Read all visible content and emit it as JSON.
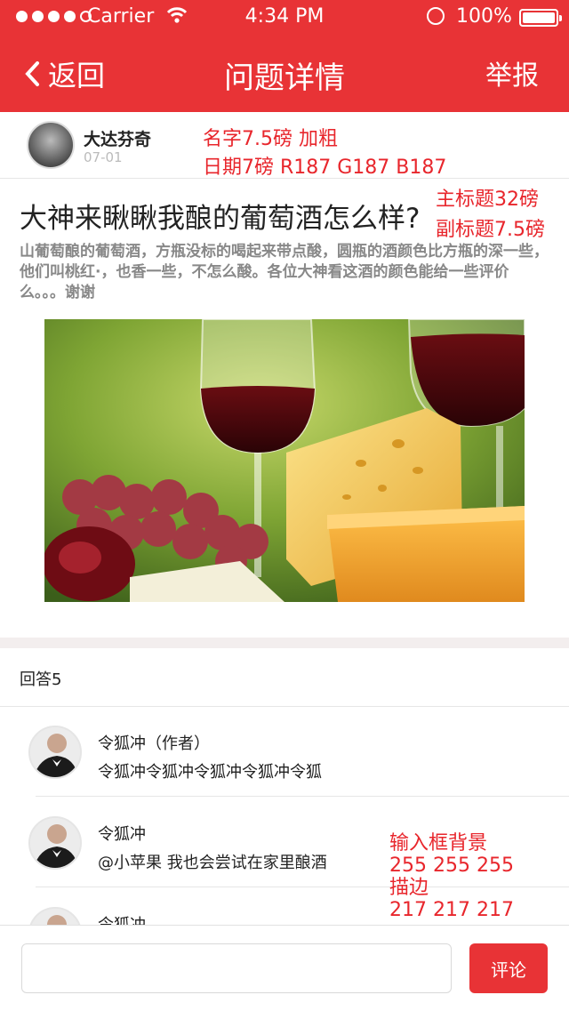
{
  "status_bar": {
    "carrier": "Carrier",
    "time": "4:34 PM",
    "battery": "100%"
  },
  "nav": {
    "back_label": "返回",
    "title": "问题详情",
    "report_label": "举报"
  },
  "author": {
    "name": "大达芬奇",
    "date": "07-01"
  },
  "annotations": {
    "name_spec": "名字7.5磅 加粗",
    "date_spec": "日期7磅 R187 G187 B187",
    "title_spec": "主标题32磅",
    "subtitle_spec": "副标题7.5磅",
    "input_spec_1": "输入框背景",
    "input_spec_2": "255 255 255",
    "input_spec_3": "描边",
    "input_spec_4": "217 217 217"
  },
  "question": {
    "title": "大神来瞅瞅我酿的葡萄酒怎么样?",
    "body": "山葡萄酿的葡萄酒，方瓶没标的喝起来带点酸，圆瓶的酒颜色比方瓶的深一些，他们叫桃红·，也香一些，不怎么酸。各位大神看这酒的颜色能给一些评价么。。。谢谢"
  },
  "answers_header": "回答5",
  "answers": [
    {
      "name": "令狐冲（作者）",
      "text": "令狐冲令狐冲令狐冲令狐冲令狐"
    },
    {
      "name": "令狐冲",
      "text": "@小苹果 我也会尝试在家里酿酒"
    },
    {
      "name": "令狐冲",
      "text": ""
    }
  ],
  "comment": {
    "placeholder": "",
    "button_label": "评论"
  },
  "colors": {
    "accent": "#e83336",
    "date_gray": "#bbbbbb",
    "input_border": "#d9d9d9"
  }
}
